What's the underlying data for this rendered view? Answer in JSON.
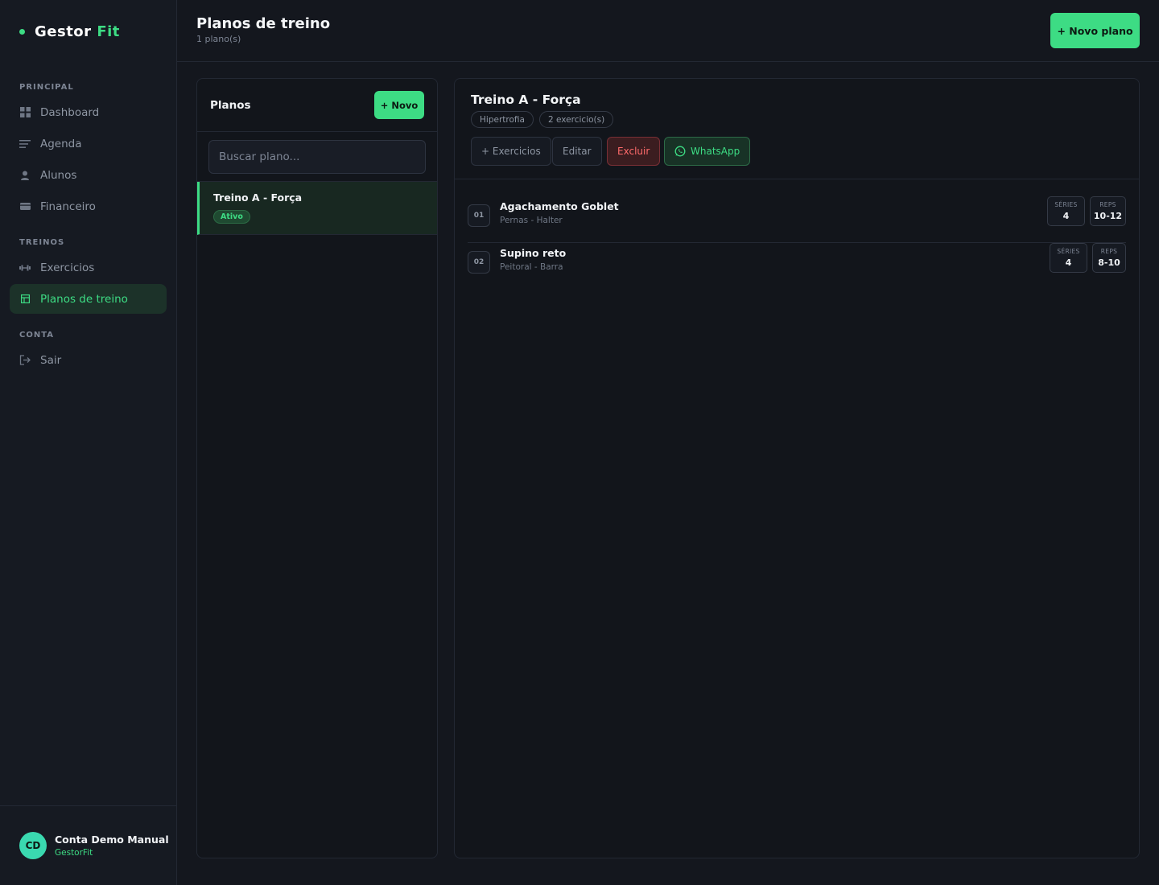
{
  "app": {
    "logo_main": "Gestor",
    "logo_accent": "Fit"
  },
  "sidebar": {
    "sections": [
      {
        "label": "PRINCIPAL"
      },
      {
        "label": "TREINOS"
      },
      {
        "label": "CONTA"
      }
    ],
    "items": [
      {
        "label": "Dashboard",
        "icon": "grid-icon"
      },
      {
        "label": "Agenda",
        "icon": "list-icon"
      },
      {
        "label": "Alunos",
        "icon": "user-icon"
      },
      {
        "label": "Financeiro",
        "icon": "wallet-icon"
      },
      {
        "label": "Exercicios",
        "icon": "dumbbell-icon"
      },
      {
        "label": "Planos de treino",
        "icon": "table-icon",
        "active": true
      },
      {
        "label": "Sair",
        "icon": "logout-icon"
      }
    ],
    "user": {
      "initials": "CD",
      "name": "Conta Demo Manual",
      "org": "GestorFit"
    }
  },
  "header": {
    "title": "Planos de treino",
    "subtitle": "1 plano(s)",
    "new_plan_label": "+ Novo plano"
  },
  "plans": {
    "title": "Planos",
    "new_label": "+ Novo",
    "search_placeholder": "Buscar plano...",
    "items": [
      {
        "name": "Treino A - Força",
        "status": "Ativo"
      }
    ]
  },
  "detail": {
    "title": "Treino A - Força",
    "tags": [
      "Hipertrofia",
      "2 exercicio(s)"
    ],
    "actions": {
      "exercises": "+ Exercicios",
      "edit": "Editar",
      "delete": "Excluir",
      "whatsapp": "WhatsApp"
    },
    "exercises": [
      {
        "num": "01",
        "name": "Agachamento Goblet",
        "meta": "Pernas - Halter",
        "series_label": "SÉRIES",
        "series": "4",
        "reps_label": "REPS",
        "reps": "10-12"
      },
      {
        "num": "02",
        "name": "Supino reto",
        "meta": "Peitoral - Barra",
        "series_label": "SÉRIES",
        "series": "4",
        "reps_label": "REPS",
        "reps": "8-10"
      }
    ]
  },
  "colors": {
    "accent": "#3ddc84",
    "danger": "#ff6b6b",
    "background": "#14171e"
  }
}
